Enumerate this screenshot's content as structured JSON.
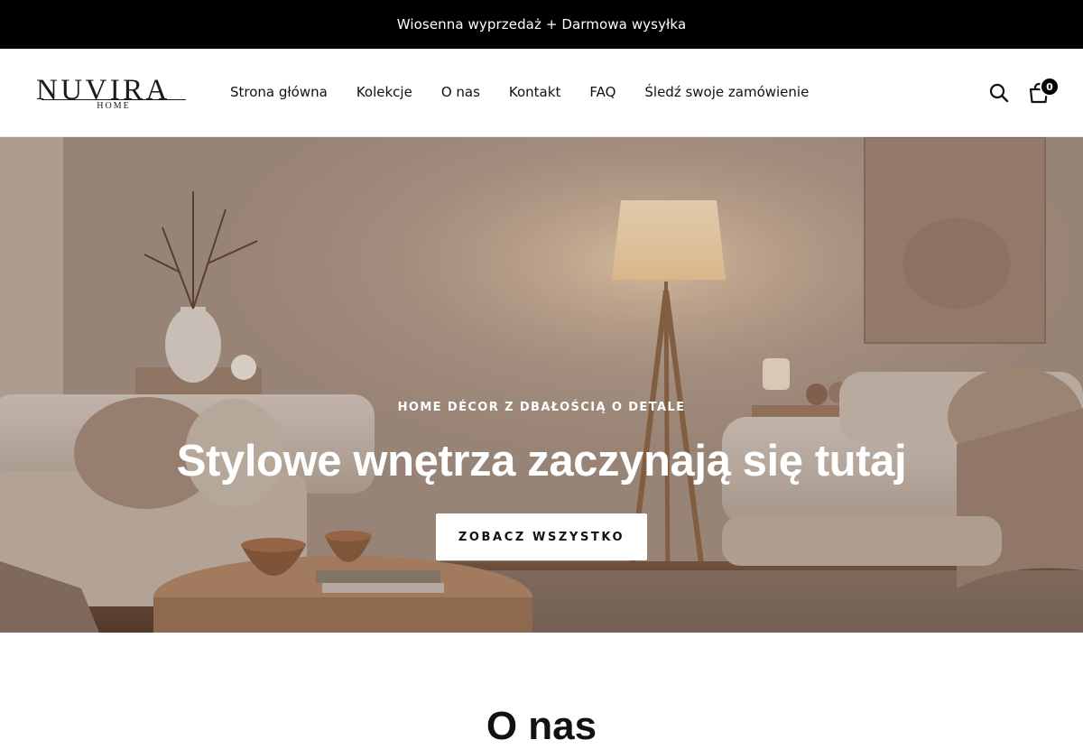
{
  "announcement": {
    "text": "Wiosenna wyprzedaż + Darmowa wysyłka"
  },
  "brand": {
    "name": "NUVIRA",
    "subtitle": "HOME"
  },
  "nav": {
    "items": [
      {
        "label": "Strona główna"
      },
      {
        "label": "Kolekcje"
      },
      {
        "label": "O nas"
      },
      {
        "label": "Kontakt"
      },
      {
        "label": "FAQ"
      },
      {
        "label": "Śledź swoje zamówienie"
      }
    ]
  },
  "header_actions": {
    "search_icon": "search-icon",
    "cart_icon": "cart-icon",
    "cart_count": "0"
  },
  "hero": {
    "eyebrow": "HOME DÉCOR Z DBAŁOŚCIĄ O DETALE",
    "title": "Stylowe wnętrza zaczynają się tutaj",
    "cta_label": "ZOBACZ WSZYSTKO"
  },
  "about": {
    "heading": "O nas"
  },
  "colors": {
    "announcement_bg": "#000000",
    "text": "#111111",
    "hero_button_bg": "#ffffff"
  }
}
